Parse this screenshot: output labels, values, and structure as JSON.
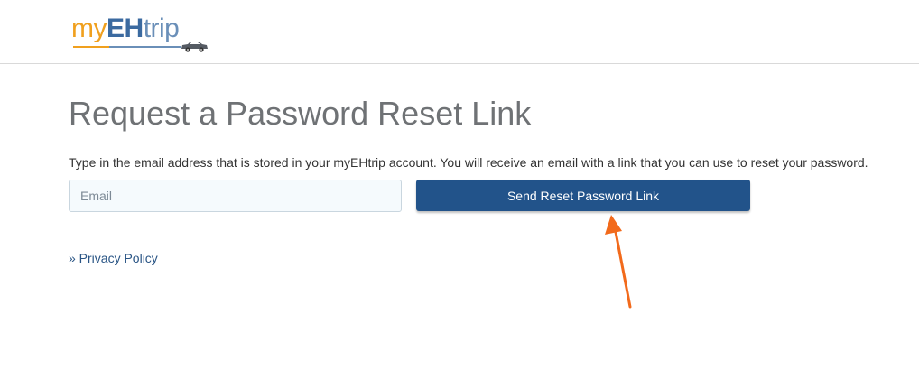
{
  "header": {
    "logo": {
      "part_my": "my",
      "part_eh": "EH",
      "part_trip": "trip",
      "colors": {
        "my": "#f0a01e",
        "eh": "#3b6aa0",
        "trip": "#6a8fb8"
      },
      "icon": "car-icon"
    }
  },
  "main": {
    "title": "Request a Password Reset Link",
    "instructions": "Type in the email address that is stored in your myEHtrip account. You will receive an email with a link that you can use to reset your password.",
    "email_field": {
      "value": "",
      "placeholder": "Email"
    },
    "send_button_label": "Send Reset Password Link",
    "privacy_link": "» Privacy Policy"
  },
  "annotation": {
    "icon": "arrow-icon",
    "color": "#f26a1b"
  },
  "colors": {
    "button": "#22538a",
    "link": "#2a5585",
    "title": "#6f7275"
  }
}
